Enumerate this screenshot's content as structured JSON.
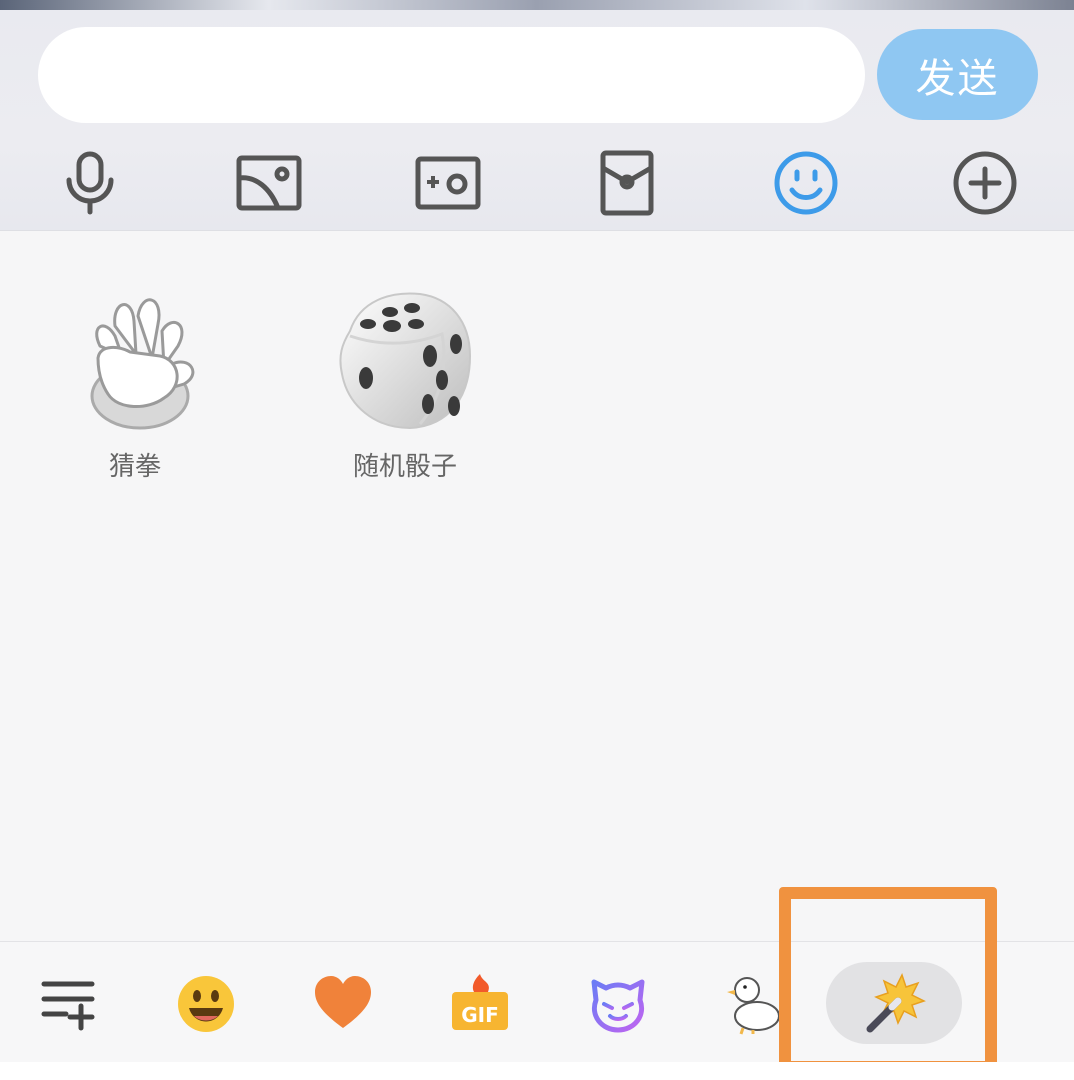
{
  "composer": {
    "input_value": "",
    "input_placeholder": "",
    "send_label": "发送",
    "send_color": "#8fc7f2"
  },
  "toolbar": {
    "icons": [
      "microphone-icon",
      "image-icon",
      "camera-icon",
      "red-packet-icon",
      "emoji-icon",
      "plus-icon"
    ],
    "active_color": "#3d9be9"
  },
  "stickers": [
    {
      "label": "猜拳",
      "icon": "rock-paper-scissors-hand"
    },
    {
      "label": "随机骰子",
      "icon": "dice"
    }
  ],
  "bottom_tabs": {
    "icons": [
      "manage-list-icon",
      "smiley-emoji-icon",
      "heart-icon",
      "gif-icon",
      "cat-face-icon",
      "duck-sticker-icon",
      "magic-wand-icon"
    ],
    "selected": "magic-wand-icon"
  },
  "highlight_color": "#f0923f"
}
